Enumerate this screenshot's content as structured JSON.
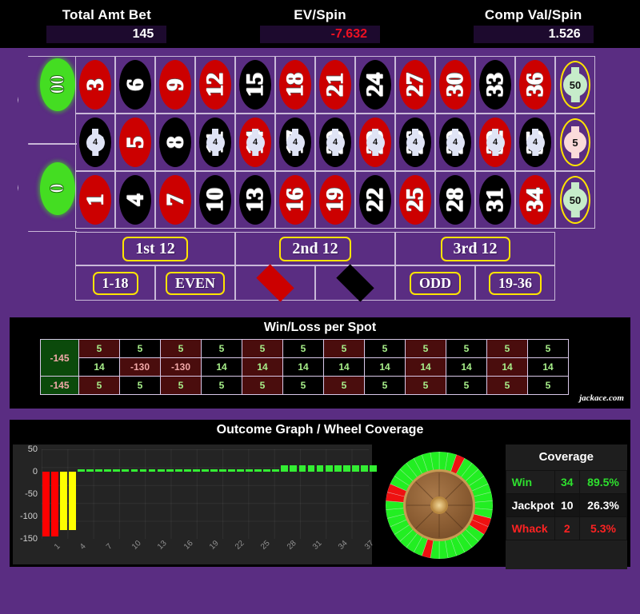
{
  "header": {
    "stats": [
      {
        "label": "Total Amt Bet",
        "value": "145",
        "negative": false
      },
      {
        "label": "EV/Spin",
        "value": "-7.632",
        "negative": true
      },
      {
        "label": "Comp Val/Spin",
        "value": "1.526",
        "negative": false
      }
    ]
  },
  "table": {
    "zeros": [
      {
        "label": "00",
        "color": "green"
      },
      {
        "label": "0",
        "color": "green"
      }
    ],
    "rows": [
      {
        "name": "top-row",
        "numbers": [
          {
            "n": "3",
            "color": "red"
          },
          {
            "n": "6",
            "color": "black"
          },
          {
            "n": "9",
            "color": "red"
          },
          {
            "n": "12",
            "color": "red"
          },
          {
            "n": "15",
            "color": "black"
          },
          {
            "n": "18",
            "color": "red"
          },
          {
            "n": "21",
            "color": "red"
          },
          {
            "n": "24",
            "color": "black"
          },
          {
            "n": "27",
            "color": "red"
          },
          {
            "n": "30",
            "color": "red"
          },
          {
            "n": "33",
            "color": "black"
          },
          {
            "n": "36",
            "color": "red"
          }
        ],
        "two_to_one_chip": "50"
      },
      {
        "name": "middle-row",
        "numbers": [
          {
            "n": "2",
            "color": "black",
            "chip": "4"
          },
          {
            "n": "5",
            "color": "red"
          },
          {
            "n": "8",
            "color": "black"
          },
          {
            "n": "11",
            "color": "black",
            "chip": "4"
          },
          {
            "n": "14",
            "color": "red",
            "chip": "4"
          },
          {
            "n": "17",
            "color": "black",
            "chip": "4"
          },
          {
            "n": "20",
            "color": "black",
            "chip": "4"
          },
          {
            "n": "23",
            "color": "red",
            "chip": "4"
          },
          {
            "n": "26",
            "color": "black",
            "chip": "4"
          },
          {
            "n": "29",
            "color": "black",
            "chip": "4"
          },
          {
            "n": "32",
            "color": "red",
            "chip": "4"
          },
          {
            "n": "35",
            "color": "black",
            "chip": "4"
          }
        ],
        "two_to_one_chip": "5"
      },
      {
        "name": "bottom-row",
        "numbers": [
          {
            "n": "1",
            "color": "red"
          },
          {
            "n": "4",
            "color": "black"
          },
          {
            "n": "7",
            "color": "red"
          },
          {
            "n": "10",
            "color": "black"
          },
          {
            "n": "13",
            "color": "black"
          },
          {
            "n": "16",
            "color": "red"
          },
          {
            "n": "19",
            "color": "red"
          },
          {
            "n": "22",
            "color": "black"
          },
          {
            "n": "25",
            "color": "red"
          },
          {
            "n": "28",
            "color": "black"
          },
          {
            "n": "31",
            "color": "black"
          },
          {
            "n": "34",
            "color": "red"
          }
        ],
        "two_to_one_chip": "50"
      }
    ],
    "dozens": [
      "1st 12",
      "2nd 12",
      "3rd 12"
    ],
    "outside": [
      {
        "label": "1-18",
        "kind": "pill"
      },
      {
        "label": "EVEN",
        "kind": "pill"
      },
      {
        "label": "RED",
        "kind": "diamond-red"
      },
      {
        "label": "BLACK",
        "kind": "diamond-black"
      },
      {
        "label": "ODD",
        "kind": "pill"
      },
      {
        "label": "19-36",
        "kind": "pill"
      }
    ]
  },
  "winloss": {
    "title": "Win/Loss per Spot",
    "zero_cells": [
      "-145",
      "-145"
    ],
    "rows": [
      [
        "5",
        "5",
        "5",
        "5",
        "5",
        "5",
        "5",
        "5",
        "5",
        "5",
        "5",
        "5"
      ],
      [
        "14",
        "-130",
        "-130",
        "14",
        "14",
        "14",
        "14",
        "14",
        "14",
        "14",
        "14",
        "14"
      ],
      [
        "5",
        "5",
        "5",
        "5",
        "5",
        "5",
        "5",
        "5",
        "5",
        "5",
        "5",
        "5"
      ]
    ],
    "brand": "jackace.com"
  },
  "outcome": {
    "title": "Outcome Graph / Wheel Coverage"
  },
  "chart_data": {
    "type": "bar",
    "title": "Outcome Graph / Wheel Coverage",
    "xlabel": "",
    "ylabel": "",
    "ylim": [
      -150,
      50
    ],
    "yticks": [
      50,
      0,
      -50,
      -100,
      -150
    ],
    "xticks": [
      "1",
      "4",
      "7",
      "10",
      "13",
      "16",
      "19",
      "22",
      "25",
      "28",
      "31",
      "34",
      "37"
    ],
    "grid": true,
    "categories": [
      "00",
      "0",
      "1",
      "2",
      "3",
      "4",
      "5",
      "6",
      "7",
      "8",
      "9",
      "10",
      "11",
      "12",
      "13",
      "14",
      "15",
      "16",
      "17",
      "18",
      "19",
      "20",
      "21",
      "22",
      "23",
      "24",
      "25",
      "26",
      "27",
      "28",
      "29",
      "30",
      "31",
      "32",
      "33",
      "34",
      "35",
      "36"
    ],
    "values": [
      -145,
      -145,
      -130,
      -130,
      5,
      5,
      5,
      5,
      5,
      5,
      5,
      5,
      5,
      5,
      5,
      5,
      5,
      5,
      5,
      5,
      5,
      5,
      5,
      5,
      5,
      5,
      5,
      14,
      14,
      14,
      14,
      14,
      14,
      14,
      14,
      14,
      14,
      14
    ],
    "colors": [
      "red",
      "red",
      "yellow",
      "yellow",
      "green",
      "green",
      "green",
      "green",
      "green",
      "green",
      "green",
      "green",
      "green",
      "green",
      "green",
      "green",
      "green",
      "green",
      "green",
      "green",
      "green",
      "green",
      "green",
      "green",
      "green",
      "green",
      "green",
      "green",
      "green",
      "green",
      "green",
      "green",
      "green",
      "green",
      "green",
      "green",
      "green",
      "green"
    ]
  },
  "coverage": {
    "title": "Coverage",
    "rows": [
      {
        "label": "Win",
        "count": "34",
        "pct": "89.5%",
        "color": "win"
      },
      {
        "label": "Jackpot",
        "count": "10",
        "pct": "26.3%",
        "color": "jackpot"
      },
      {
        "label": "Whack",
        "count": "2",
        "pct": "5.3%",
        "color": "whack"
      }
    ]
  },
  "wheel": {
    "green_color": "#22ee22",
    "red_color": "#ee1111",
    "whack_positions": [
      0.05,
      0.3,
      0.53,
      0.78
    ]
  }
}
